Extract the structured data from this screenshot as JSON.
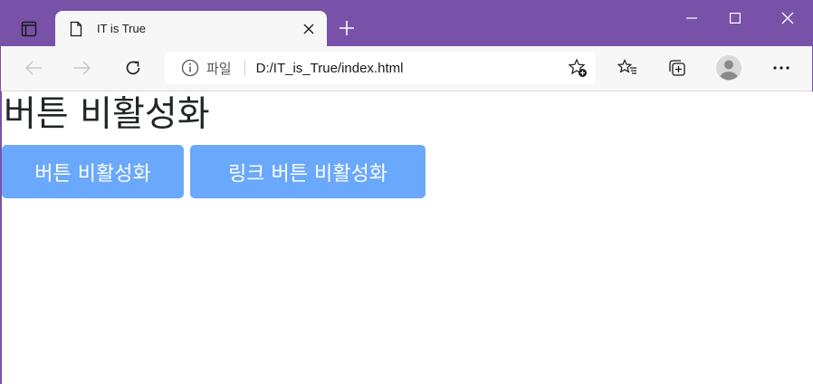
{
  "browser": {
    "tab": {
      "title": "IT is True"
    },
    "address_bar": {
      "site_label": "파일",
      "url": "D:/IT_is_True/index.html"
    }
  },
  "page": {
    "heading": "버튼 비활성화",
    "buttons": [
      {
        "label": "버튼 비활성화",
        "disabled": true
      },
      {
        "label": "링크 버튼 비활성화",
        "disabled": true
      }
    ]
  },
  "colors": {
    "titlebar": "#7852a9",
    "toolbar": "#f7f7f7",
    "button_bg": "#6aa8fc",
    "button_text": "#ffffff",
    "heading_text": "#212529"
  },
  "icons": {
    "tab_actions": "tab-actions-icon",
    "page": "page-icon",
    "close_tab": "close-icon",
    "new_tab": "plus-icon",
    "minimize": "minimize-icon",
    "maximize": "maximize-icon",
    "close_window": "close-icon",
    "back": "arrow-left-icon",
    "forward": "arrow-right-icon",
    "refresh": "refresh-icon",
    "info": "info-icon",
    "add_favorite": "star-plus-icon",
    "favorites": "favorites-icon",
    "collections": "collections-icon",
    "profile": "avatar-icon",
    "more": "more-icon"
  }
}
